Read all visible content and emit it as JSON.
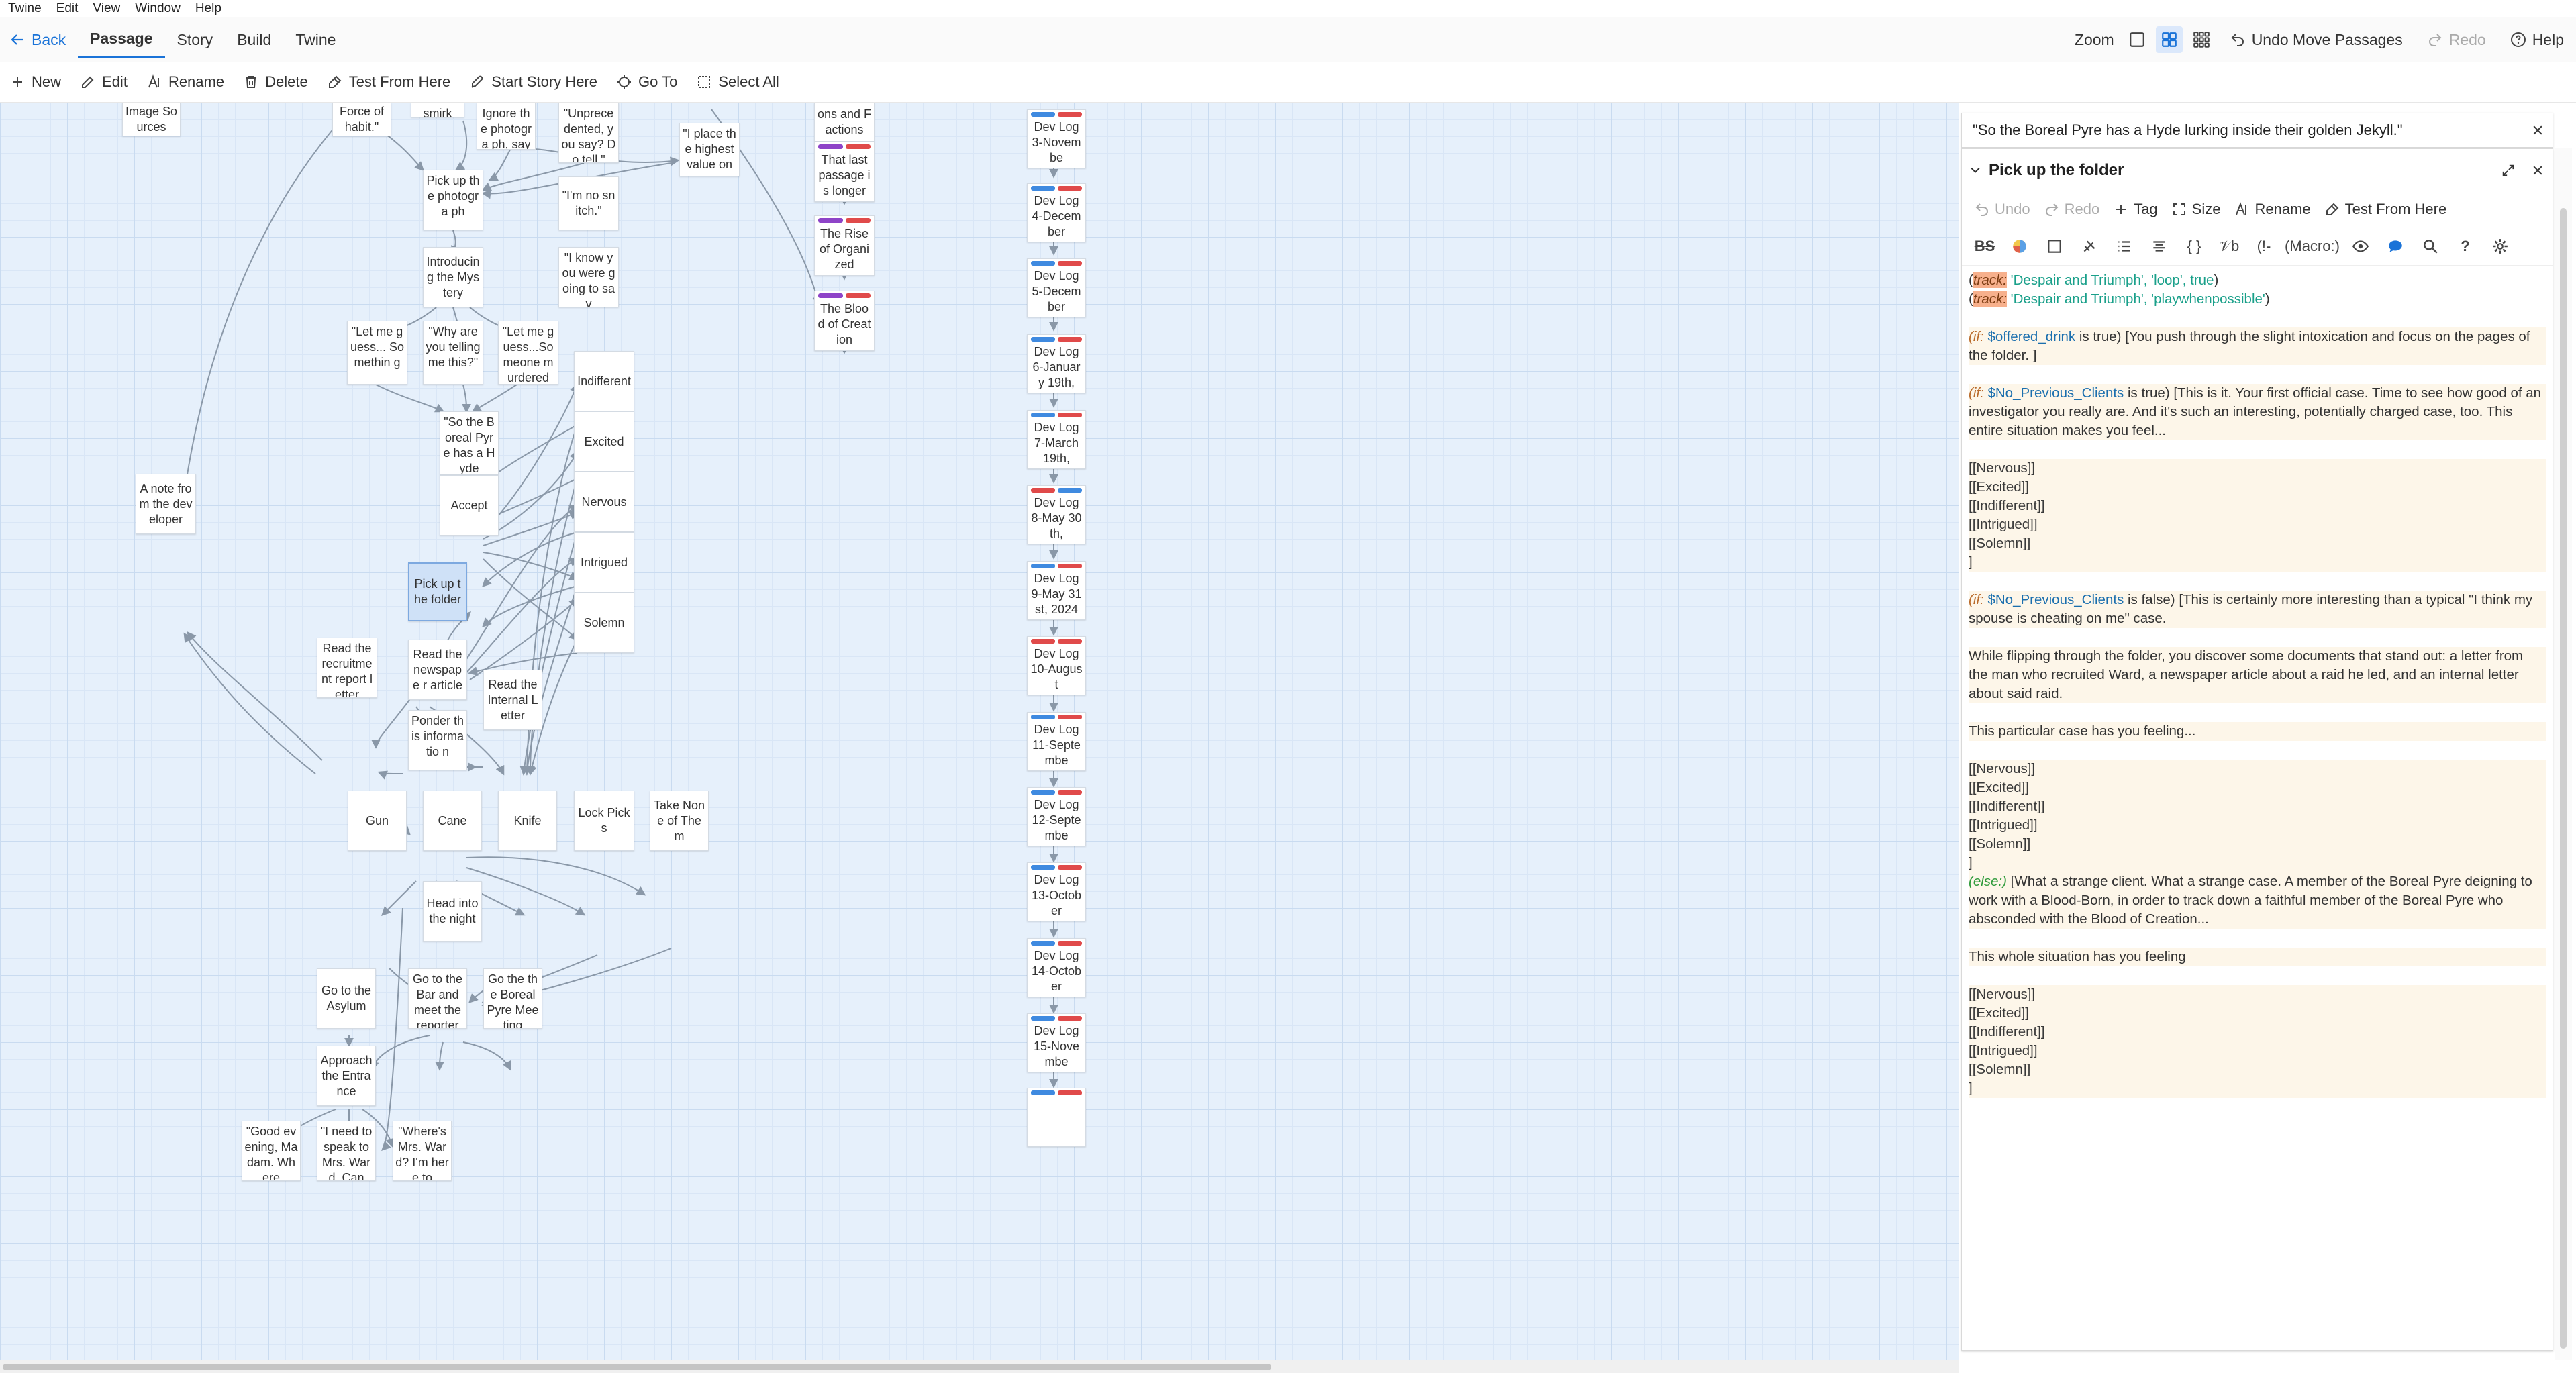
{
  "menubar": [
    "Twine",
    "Edit",
    "View",
    "Window",
    "Help"
  ],
  "topbar": {
    "back": "Back",
    "tabs": [
      "Passage",
      "Story",
      "Build",
      "Twine"
    ],
    "zoom_label": "Zoom",
    "undo": "Undo Move Passages",
    "redo": "Redo",
    "help": "Help"
  },
  "subbar": {
    "new": "New",
    "edit": "Edit",
    "rename": "Rename",
    "delete": "Delete",
    "test_from_here": "Test From Here",
    "start_story_here": "Start Story Here",
    "go_to": "Go To",
    "select_all": "Select All"
  },
  "colors": {
    "accent": "#1a73d8",
    "tag_red": "#e04a4a",
    "tag_blue": "#3f8ae0",
    "tag_purple": "#8e44c8",
    "selected_card": "#cfe1f7"
  },
  "passages": [
    {
      "id": "image-sources",
      "text": "Image Sources"
    },
    {
      "id": "force-of-habit",
      "text": "Force of habit.\""
    },
    {
      "id": "smirk",
      "text": "smirk"
    },
    {
      "id": "ignore-photo",
      "text": "Ignore the photogra ph, say you're not"
    },
    {
      "id": "unprecedented",
      "text": "\"Unprece dented, you say? Do tell.\""
    },
    {
      "id": "i-place",
      "text": "\"I place the highest value on"
    },
    {
      "id": "pick-up-photo",
      "text": "Pick up the photogra ph"
    },
    {
      "id": "no-snitch",
      "text": "\"I'm no snitch.\""
    },
    {
      "id": "introducing",
      "text": "Introducin g the Mystery"
    },
    {
      "id": "i-know",
      "text": "\"I know you were going to say"
    },
    {
      "id": "let-me-guess-1",
      "text": "\"Let me guess... Somethin g"
    },
    {
      "id": "why-telling",
      "text": "\"Why are you telling me this?\""
    },
    {
      "id": "let-me-guess-2",
      "text": "\"Let me guess...So meone murdered"
    },
    {
      "id": "indifferent",
      "text": "Indifferent"
    },
    {
      "id": "excited",
      "text": "Excited"
    },
    {
      "id": "boreal-hyde",
      "text": "\"So the Boreal Pyre has a Hyde"
    },
    {
      "id": "nervous",
      "text": "Nervous"
    },
    {
      "id": "accept",
      "text": "Accept"
    },
    {
      "id": "a-note",
      "text": "A note from the developer"
    },
    {
      "id": "intrigued",
      "text": "Intrigued"
    },
    {
      "id": "pick-up-folder",
      "text": "Pick up the folder"
    },
    {
      "id": "solemn",
      "text": "Solemn"
    },
    {
      "id": "read-recruitment",
      "text": "Read the recruitme nt report letter"
    },
    {
      "id": "read-newspaper",
      "text": "Read the newspape r article"
    },
    {
      "id": "read-internal",
      "text": "Read the Internal Letter"
    },
    {
      "id": "ponder",
      "text": "Ponder this informatio n"
    },
    {
      "id": "gun",
      "text": "Gun"
    },
    {
      "id": "cane",
      "text": "Cane"
    },
    {
      "id": "knife",
      "text": "Knife"
    },
    {
      "id": "lock-picks",
      "text": "Lock Picks"
    },
    {
      "id": "take-none",
      "text": "Take None of Them"
    },
    {
      "id": "head-night",
      "text": "Head into the night"
    },
    {
      "id": "go-asylum",
      "text": "Go to the Asylum"
    },
    {
      "id": "go-bar",
      "text": "Go to the Bar and meet the reporter"
    },
    {
      "id": "go-boreal",
      "text": "Go the the Boreal Pyre Meeting"
    },
    {
      "id": "approach",
      "text": "Approach the Entrance"
    },
    {
      "id": "good-evening",
      "text": "\"Good evening, Madam. Where"
    },
    {
      "id": "need-speak",
      "text": "\"I need to speak to Mrs. Ward. Can"
    },
    {
      "id": "wheres-ward",
      "text": "\"Where's Mrs. Ward? I'm here to"
    },
    {
      "id": "factions",
      "text": "ons and Factions"
    },
    {
      "id": "last-passage",
      "text": "That last passage is longer"
    },
    {
      "id": "rise",
      "text": "The Rise of Organized"
    },
    {
      "id": "blood",
      "text": "The Blood of Creation"
    },
    {
      "id": "dev3",
      "text": "Dev Log 3-Novembe"
    },
    {
      "id": "dev4",
      "text": "Dev Log 4-December"
    },
    {
      "id": "dev5",
      "text": "Dev Log 5-December"
    },
    {
      "id": "dev6",
      "text": "Dev Log 6-January 19th,"
    },
    {
      "id": "dev7",
      "text": "Dev Log 7-March 19th,"
    },
    {
      "id": "dev8",
      "text": "Dev Log 8-May 30th,"
    },
    {
      "id": "dev9",
      "text": "Dev Log 9-May 31st, 2024"
    },
    {
      "id": "dev10",
      "text": "Dev Log 10-August"
    },
    {
      "id": "dev11",
      "text": "Dev Log 11-Septembe"
    },
    {
      "id": "dev12",
      "text": "Dev Log 12-Septembe"
    },
    {
      "id": "dev13",
      "text": "Dev Log 13-October"
    },
    {
      "id": "dev14",
      "text": "Dev Log 14-October"
    },
    {
      "id": "dev15",
      "text": "Dev Log 15-Novembe"
    }
  ],
  "dialog_collapsed": {
    "title": "\"So the Boreal Pyre has a Hyde lurking inside their golden Jekyll.\""
  },
  "dialog": {
    "title": "Pick up the folder",
    "tools": {
      "undo": "Undo",
      "redo": "Redo",
      "tag": "Tag",
      "size": "Size",
      "rename": "Rename",
      "test": "Test From Here"
    },
    "format_macro_label": "(Macro:)",
    "code": {
      "l1a": "(",
      "l1b": "track:",
      "l1c": " 'Despair and Triumph', 'loop', true",
      "l1d": ")",
      "l2a": "(",
      "l2b": "track:",
      "l2c": " 'Despair and Triumph', 'playwhenpossible'",
      "l2d": ")",
      "l4a": "(if: ",
      "l4b": "$offered_drink",
      "l4c": " is true) ",
      "l4d": "[You push through the slight intoxication and focus on the pages of the folder. ]",
      "l6a": "(if: ",
      "l6b": "$No_Previous_Clients",
      "l6c": " is true) ",
      "l6d": "[This is it. Your first official case. Time to see how good of an investigator you really are. And it's such an interesting, potentially charged case, too. This entire situation makes you feel...",
      "links1": [
        "[[Nervous]]",
        "[[Excited]]",
        "[[Indifferent]]",
        "[[Intrigued]]",
        "[[Solemn]]",
        "]"
      ],
      "l8a": "(if: ",
      "l8b": "$No_Previous_Clients",
      "l8c": " is false) ",
      "l8d": "[This is certainly more interesting than a typical \"I think my spouse is cheating on me\" case.",
      "p2": "While flipping through the folder, you discover some documents that stand out: a letter from the man who recruited Ward, a newspaper article about a raid he led, and an internal letter about said raid.",
      "p3": "This particular case has you feeling...",
      "links2": [
        "[[Nervous]]",
        "[[Excited]]",
        "[[Indifferent]]",
        "[[Intrigued]]",
        "[[Solemn]]",
        "]"
      ],
      "else_a": "(else:)",
      "else_b": " [What a strange client. What a strange case. A member of the Boreal Pyre deigning to work with a Blood-Born, in order to track down a faithful member of the Boreal Pyre who absconded with the Blood of Creation...",
      "p4": "This whole situation has you feeling",
      "links3": [
        "[[Nervous]]",
        "[[Excited]]",
        "[[Indifferent]]",
        "[[Intrigued]]",
        "[[Solemn]]",
        "]"
      ]
    }
  }
}
